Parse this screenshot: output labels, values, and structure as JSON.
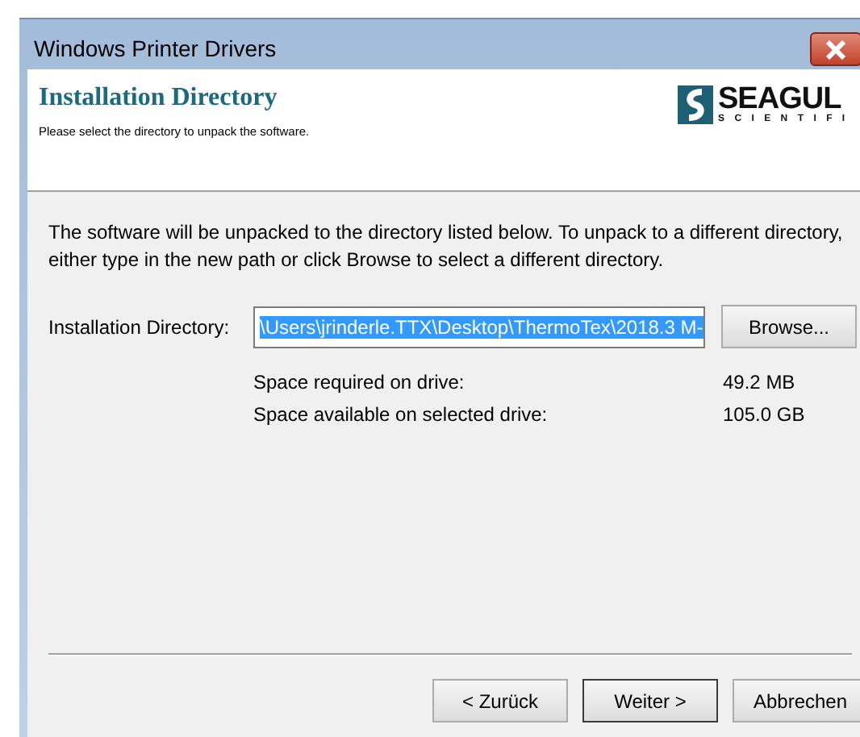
{
  "window": {
    "title": "Windows Printer Drivers"
  },
  "header": {
    "title": "Installation Directory",
    "subtitle": "Please select the directory to unpack the software.",
    "logo": {
      "name": "SEAGUL",
      "tagline": "SCIENTIFI"
    }
  },
  "instructions": "The software will be unpacked to the directory listed below.  To unpack to a different directory, either type in the new path or click Browse to select a different directory.",
  "directory": {
    "label": "Installation Directory:",
    "value": "\\Users\\jrinderle.TTX\\Desktop\\ThermoTex\\2018.3 M-",
    "text_selected": true,
    "browse_button": "Browse..."
  },
  "space": [
    {
      "label": "Space required on drive:",
      "value": "49.2 MB"
    },
    {
      "label": "Space available on selected drive:",
      "value": "105.0 GB"
    }
  ],
  "buttons": [
    {
      "label": "< Zurück",
      "focused": false
    },
    {
      "label": "Weiter >",
      "focused": true
    },
    {
      "label": "Abbrechen",
      "focused": false
    }
  ]
}
